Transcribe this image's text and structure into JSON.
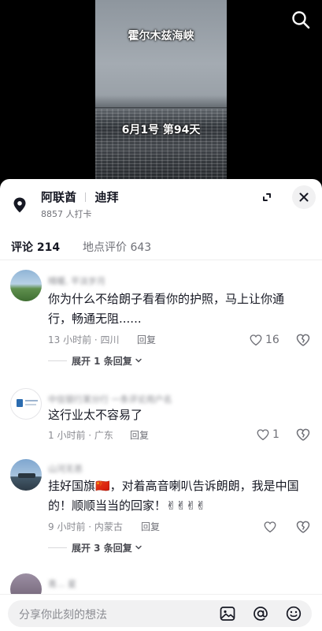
{
  "video": {
    "title_overlay": "霍尔木兹海峡",
    "date_overlay": "6月1号 第94天",
    "search_icon": "search-icon"
  },
  "location": {
    "name_part1": "阿联酋",
    "name_part2": "迪拜",
    "checkins": "8857 人打卡",
    "pin_icon": "location-pin-icon"
  },
  "tabs": [
    {
      "label": "评论 214",
      "active": true
    },
    {
      "label": "地点评价 643",
      "active": false
    }
  ],
  "comments": [
    {
      "username": "晴暖, 平淡岁月",
      "text": "你为什么不给朗子看看你的护照，马上让你通行，畅通无阻......",
      "time_region": "13 小时前 · 四川",
      "reply_label": "回复",
      "likes": "16",
      "expand_label": "展开 1 条回复"
    },
    {
      "username": "中信银行某分行 一条评论用户名",
      "text": "这行业太不容易了",
      "time_region": "1 小时前 · 广东",
      "reply_label": "回复",
      "likes": "1"
    },
    {
      "username": "山河无恙",
      "text": "挂好国旗🇨🇳，对着高音喇叭告诉朗朗，我是中国的！顺顺当当的回家！✌✌✌✌",
      "time_region": "9 小时前 · 内蒙古",
      "reply_label": "回复",
      "likes": "",
      "expand_label": "展开 3 条回复"
    },
    {
      "username": "青... 星"
    }
  ],
  "input": {
    "placeholder": "分享你此刻的想法"
  },
  "colors": {
    "accent_text": "#161823",
    "muted_text": "#8a8b91",
    "background": "#ffffff"
  }
}
